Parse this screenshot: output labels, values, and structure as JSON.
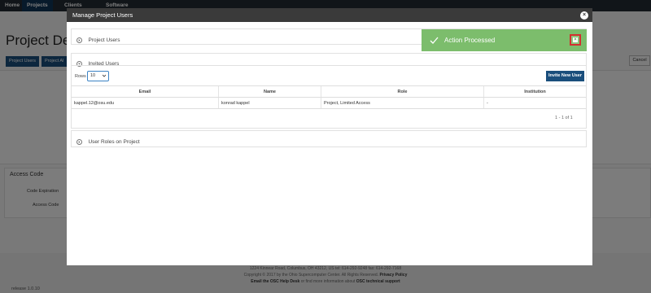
{
  "topnav": {
    "items": [
      "Home",
      "Projects",
      "Clients",
      "Software"
    ]
  },
  "background": {
    "page_title": "Project Deta",
    "tab_buttons": [
      "Project Users",
      "Project Al"
    ],
    "cancel_label": "Cancel",
    "access_code": {
      "title": "Access Code",
      "fields": [
        "Code Expiration",
        "Access Code"
      ]
    },
    "footer": {
      "address": "1224 Kinnear Road, Columbus, OH 43212, US   tel: 614-292-9248   fax: 614-292-7168",
      "copyright_prefix": "Copyright © 2017 by the Ohio Supercomputer Center. All Rights Reserved.",
      "privacy": "Privacy Policy",
      "email_prefix": "Email the",
      "help_desk": "OSC Help Desk",
      "email_mid": "or find more information about",
      "tech_support": "OSC technical support"
    },
    "release": "release 1.0.10"
  },
  "modal": {
    "title": "Manage Project Users",
    "close_icon": "close-icon",
    "sections": {
      "project_users": "Project Users",
      "invited_users": "Invited Users",
      "user_roles": "User Roles on Project"
    },
    "rows_label": "Rows",
    "rows_value": "10",
    "invite_button": "Invite New User",
    "table": {
      "columns": [
        "Email",
        "Name",
        "Role",
        "Institution"
      ],
      "rows": [
        [
          "kappel.12@osu.edu",
          "konrad kappel",
          "Project, Limited Access",
          "-"
        ]
      ]
    },
    "pager": "1 - 1 of 1"
  },
  "toast": {
    "message": "Action Processed",
    "close_glyph": "×",
    "color": "#7cbd6c",
    "icon": "check-icon"
  }
}
